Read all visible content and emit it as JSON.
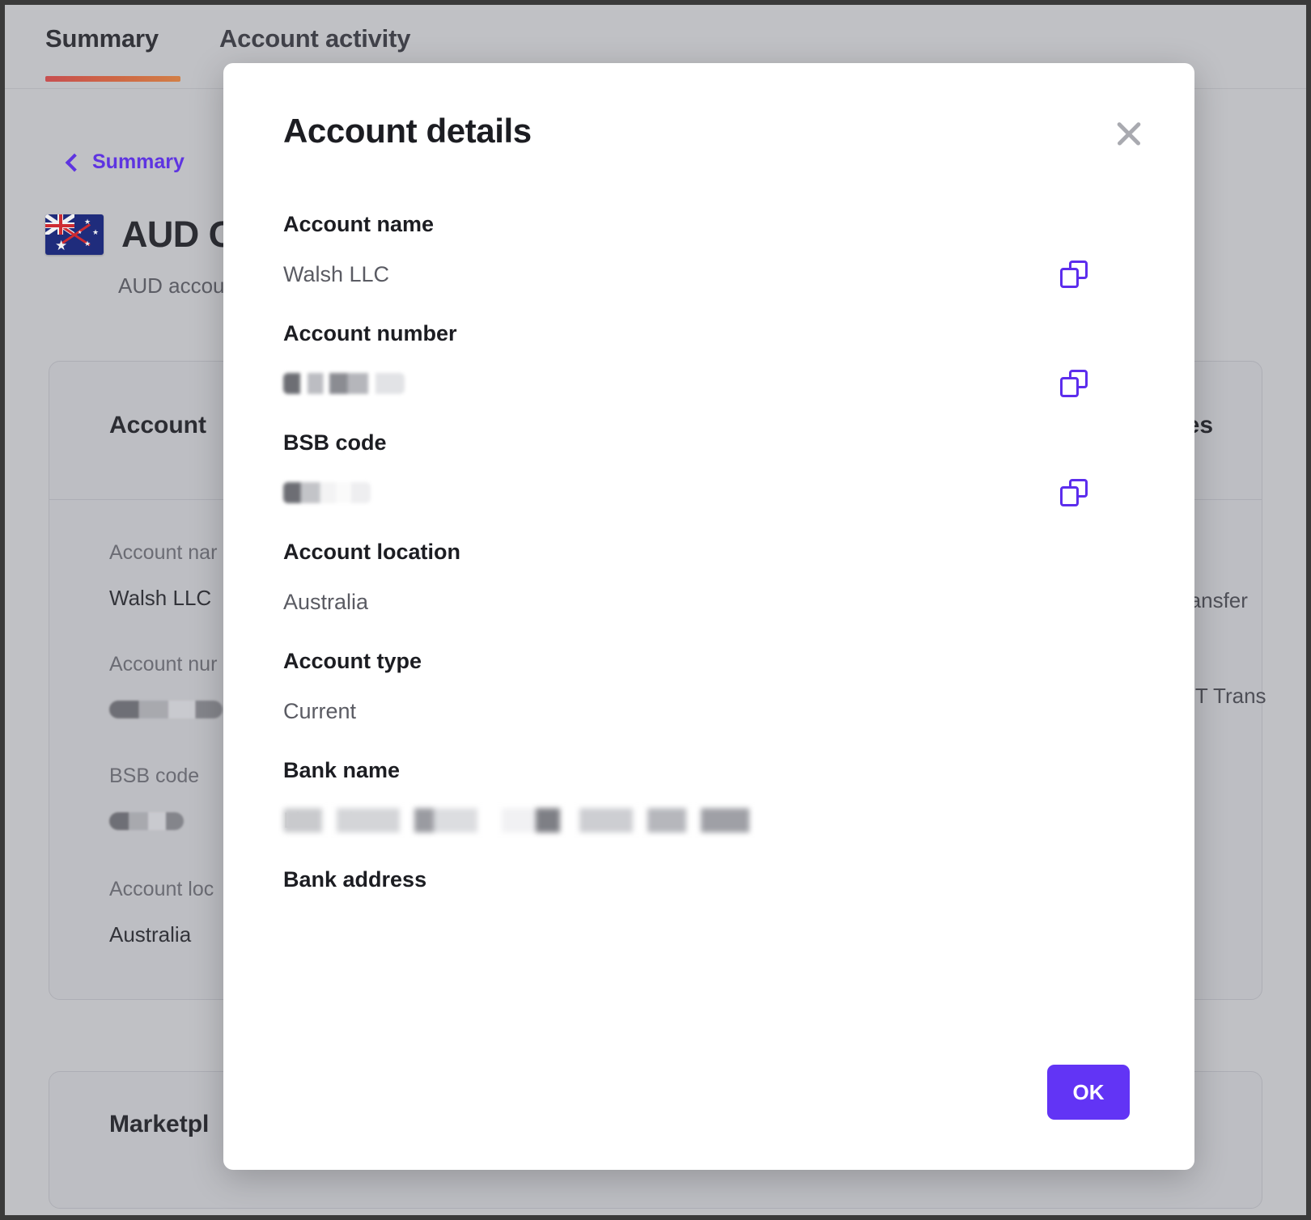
{
  "tabs": [
    {
      "label": "Summary",
      "active": true
    },
    {
      "label": "Account activity",
      "active": false
    }
  ],
  "breadcrumb": {
    "label": "Summary",
    "icon": "chevron-left-icon"
  },
  "account_header": {
    "flag": "australia-flag-icon",
    "title": "AUD G",
    "subtitle": "AUD accou"
  },
  "background_cards": {
    "account_card": {
      "heading": "Account",
      "rows": [
        {
          "label": "Account nar",
          "value": "Walsh LLC",
          "redacted": false
        },
        {
          "label": "Account nur",
          "value": "",
          "redacted": true
        },
        {
          "label": "BSB code",
          "value": "",
          "redacted": true
        },
        {
          "label": "Account loc",
          "value": "Australia",
          "redacted": false
        }
      ]
    },
    "capabilities_card": {
      "heading": "ities",
      "rows": [
        "ransfer",
        "FT Trans"
      ]
    },
    "marketplace_card": {
      "heading": "Marketpl"
    }
  },
  "modal": {
    "title": "Account details",
    "close_icon": "close-icon",
    "copy_icon": "copy-icon",
    "fields": [
      {
        "label": "Account name",
        "value": "Walsh LLC",
        "redacted": false,
        "copyable": true
      },
      {
        "label": "Account number",
        "value": "",
        "redacted": true,
        "copyable": true
      },
      {
        "label": "BSB code",
        "value": "",
        "redacted": true,
        "copyable": true
      },
      {
        "label": "Account location",
        "value": "Australia",
        "redacted": false,
        "copyable": false
      },
      {
        "label": "Account type",
        "value": "Current",
        "redacted": false,
        "copyable": false
      },
      {
        "label": "Bank name",
        "value": "Limited",
        "redacted": true,
        "copyable": false
      },
      {
        "label": "Bank address",
        "value": "",
        "redacted": false,
        "copyable": false
      }
    ],
    "ok_label": "OK"
  },
  "colors": {
    "accent_purple": "#5c2ded",
    "button_purple": "#6234f5",
    "tab_underline_from": "#d14b4b",
    "tab_underline_to": "#dd8040",
    "page_background": "#c9cacd",
    "modal_background": "#ffffff"
  }
}
